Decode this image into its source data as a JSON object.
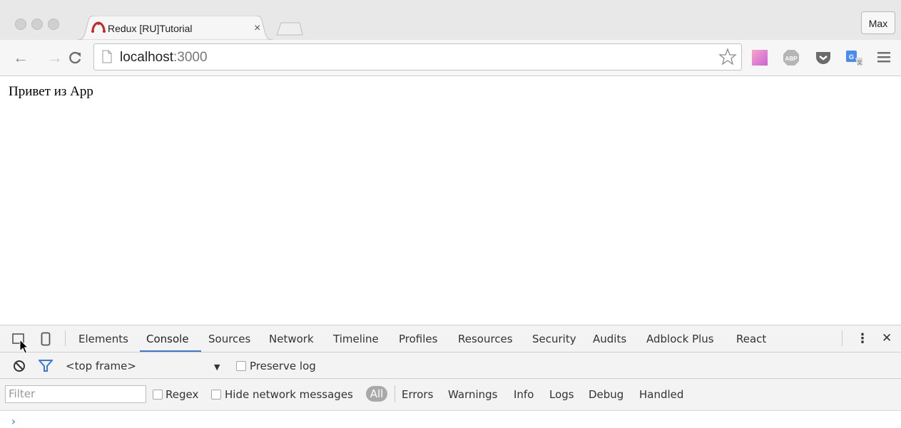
{
  "browser": {
    "tab_title": "Redux [RU]Tutorial",
    "tab_close": "×",
    "profile_name": "Max",
    "url_host": "localhost",
    "url_port": ":3000"
  },
  "page": {
    "text": "Привет из App"
  },
  "devtools": {
    "tabs": [
      "Elements",
      "Console",
      "Sources",
      "Network",
      "Timeline",
      "Profiles",
      "Resources",
      "Security",
      "Audits",
      "Adblock Plus",
      "React"
    ],
    "active_tab": "Console",
    "context": "<top frame>",
    "preserve_log": "Preserve log",
    "filter_placeholder": "Filter",
    "regex": "Regex",
    "hide_network": "Hide network messages",
    "levels": [
      "All",
      "Errors",
      "Warnings",
      "Info",
      "Logs",
      "Debug",
      "Handled"
    ],
    "prompt": "›",
    "more": "⋮",
    "close": "✕"
  },
  "colors": {
    "accent": "#3879d9"
  }
}
